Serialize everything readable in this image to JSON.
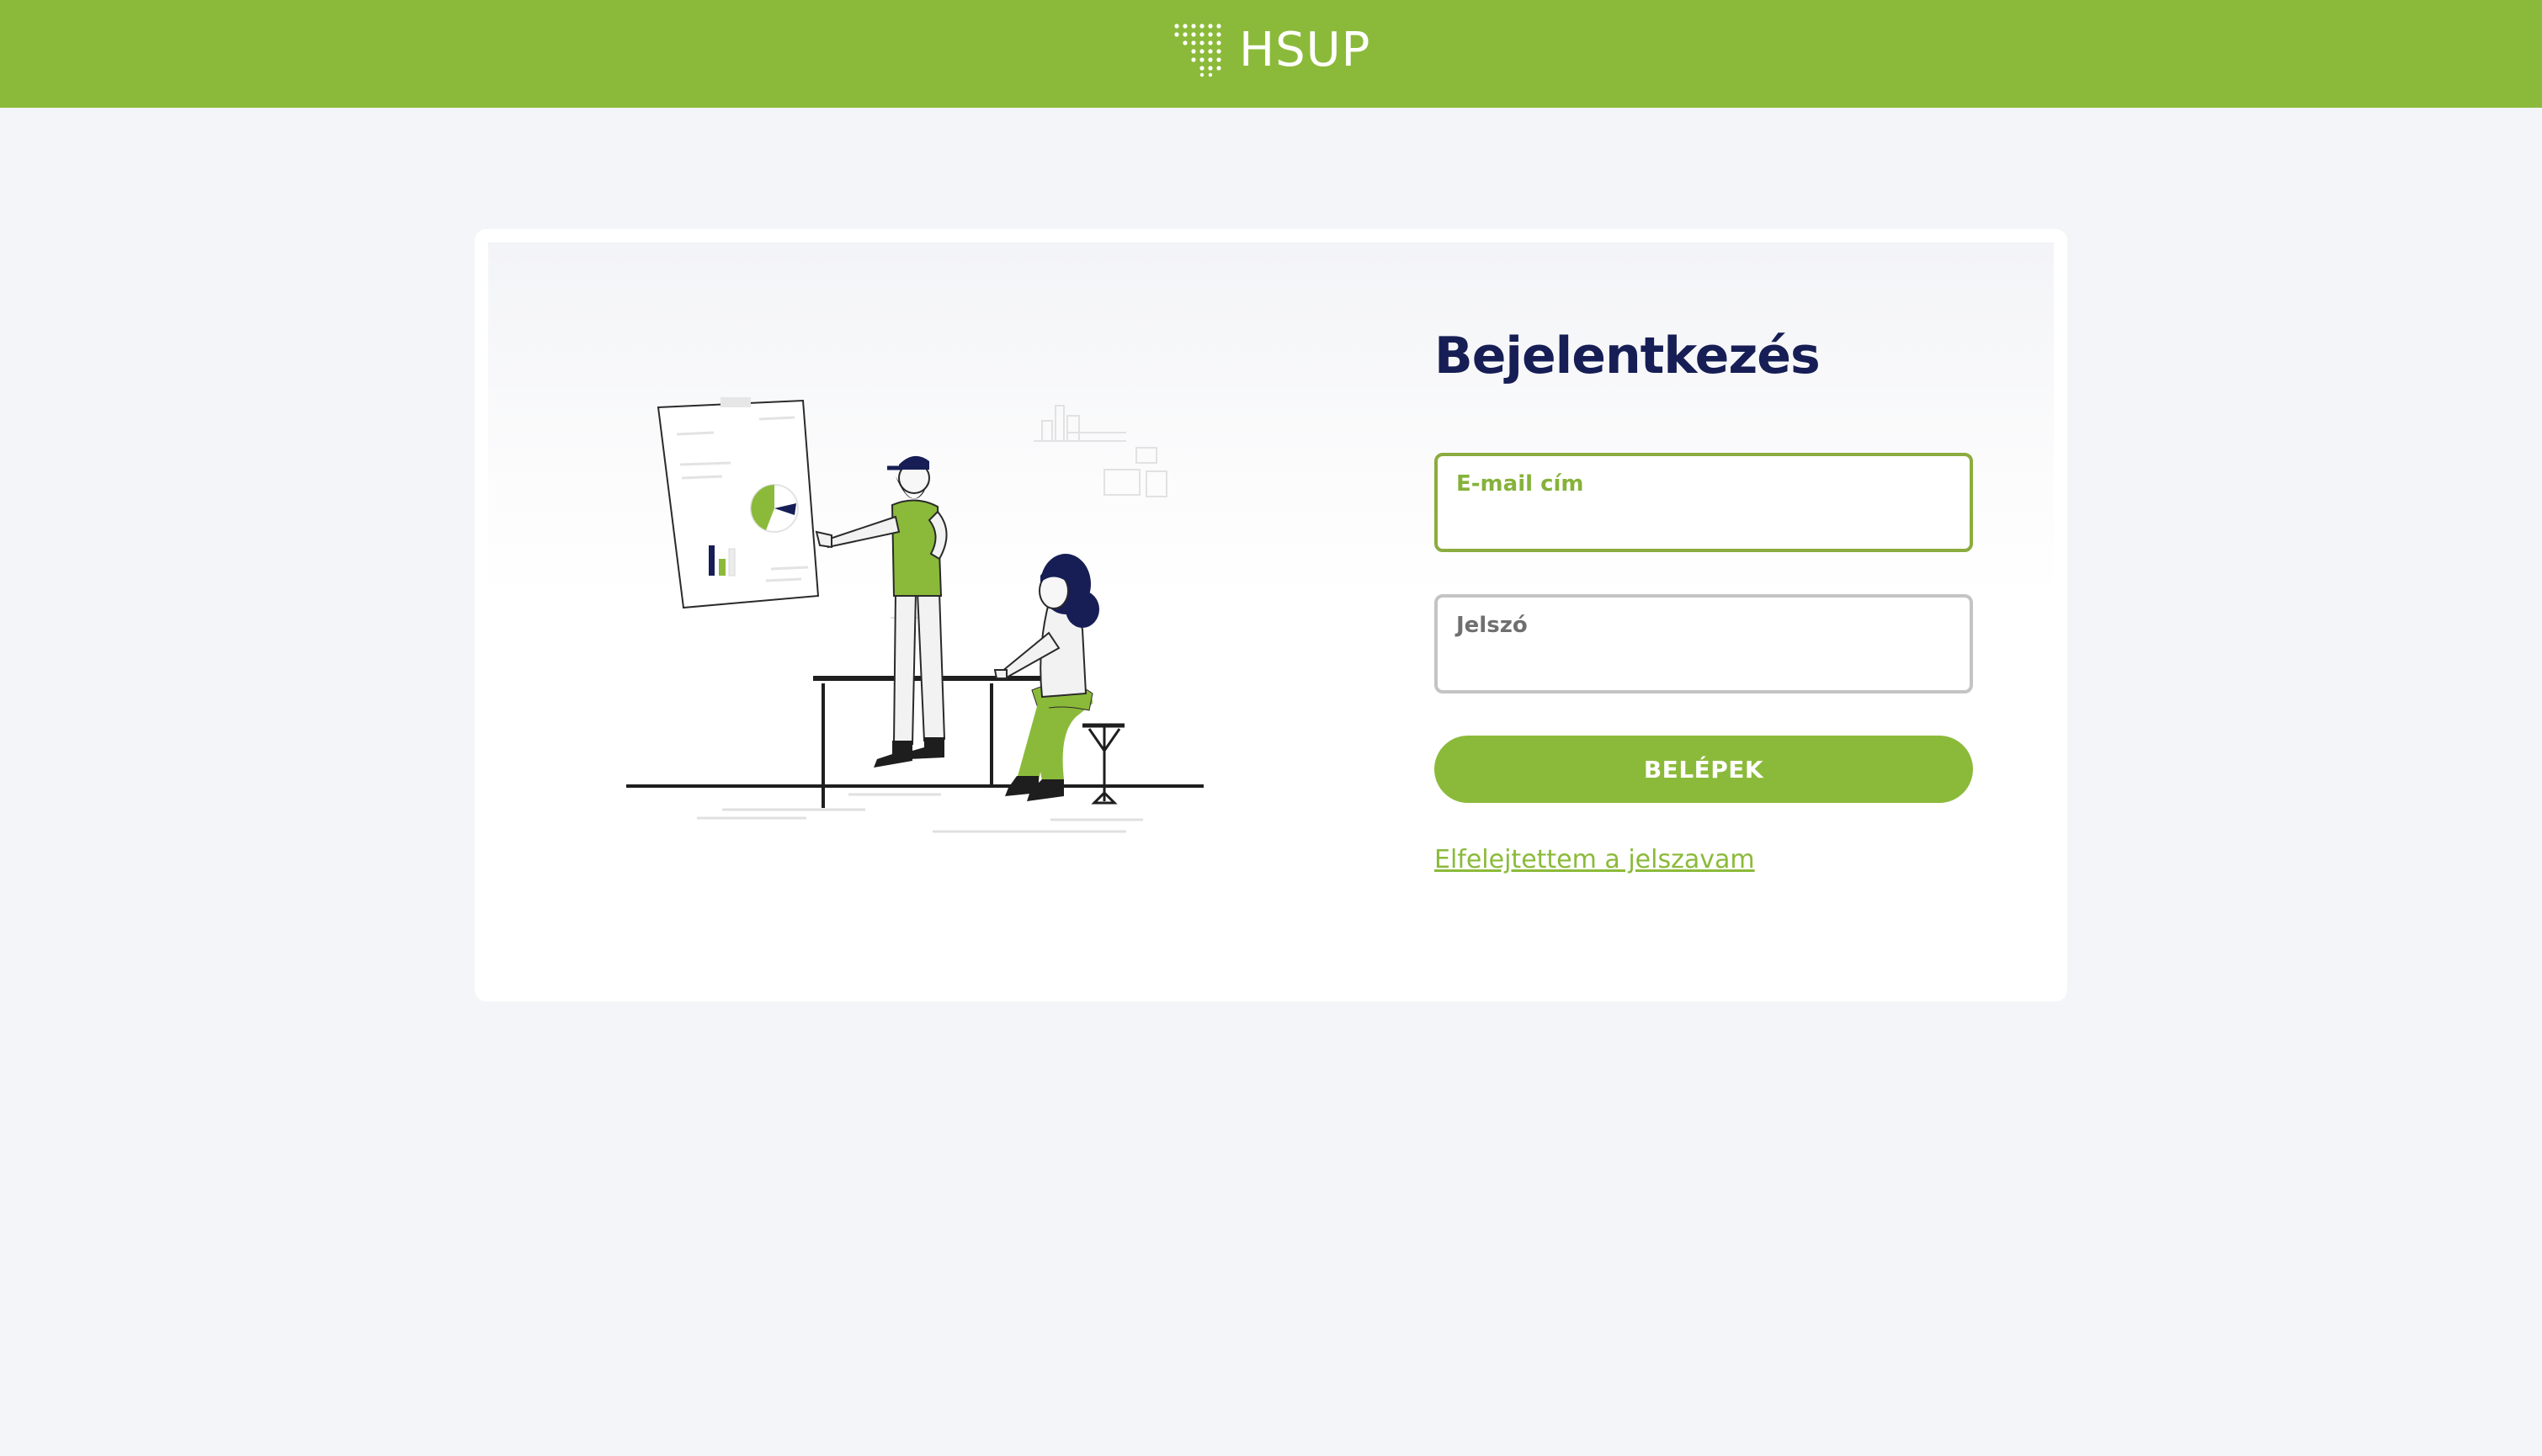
{
  "header": {
    "logo_text": "HSUP",
    "logo_icon": "dot-grid-logo",
    "background_color": "#8bba3a"
  },
  "login": {
    "title": "Bejelentkezés",
    "email_label": "E-mail cím",
    "email_value": "",
    "password_label": "Jelszó",
    "password_value": "",
    "submit_label": "BELÉPEK",
    "forgot_password_label": "Elfelejtettem a jelszavam"
  },
  "illustration": {
    "icon": "team-presentation-illustration"
  },
  "colors": {
    "accent": "#8bba3a",
    "title": "#161e55",
    "page_background": "#f4f5f8"
  }
}
